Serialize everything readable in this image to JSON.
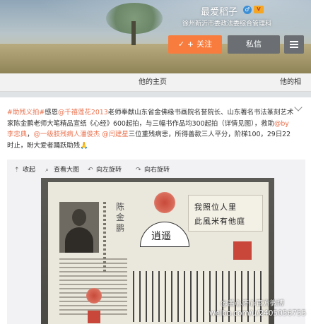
{
  "profile": {
    "name": "最爱稻子",
    "description": "徐州新沂市委政法委综合管理科",
    "follow_label": "关注",
    "message_label": "私信"
  },
  "tabs": {
    "home_label": "他的主页",
    "photos_label": "他的相"
  },
  "post": {
    "hashtag": "#助残义拍#",
    "lead": "感恩",
    "mention_1": "@千禧莲花2013",
    "text_1": "老师奉献山东省金佛缘书画院名誉院长、山东著名书法篆刻艺术家陈金鹏老师大笔精品宣纸《心经》600起拍，与三幅书作品均300起拍（详情见图），救助",
    "mention_2": "@by李忠典",
    "mention_3": "@一级肢残病人潘俊杰",
    "mention_4": "@闫建星",
    "text_2": "三位重残病患，所得善款三人平分，阶梯100，29日22时止，盼大爱者踊跃助残",
    "emoji": "🙏"
  },
  "image_toolbar": {
    "collapse": "收起",
    "view_large": "查看大图",
    "rotate_left": "向左旋转",
    "rotate_right": "向右旋转"
  },
  "image_content": {
    "name_vertical": "陈金鹏",
    "calli_line_1": "我照位人里",
    "calli_line_2": "此風米有他庭",
    "fan_char": "逍遥"
  },
  "watermark": {
    "line1": "@盖心济心官方微博",
    "line2": "weibo.com/u/2405056755"
  },
  "colors": {
    "accent_orange": "#f77c3d",
    "link": "#eb7350",
    "button_gray": "#6b6f73"
  }
}
